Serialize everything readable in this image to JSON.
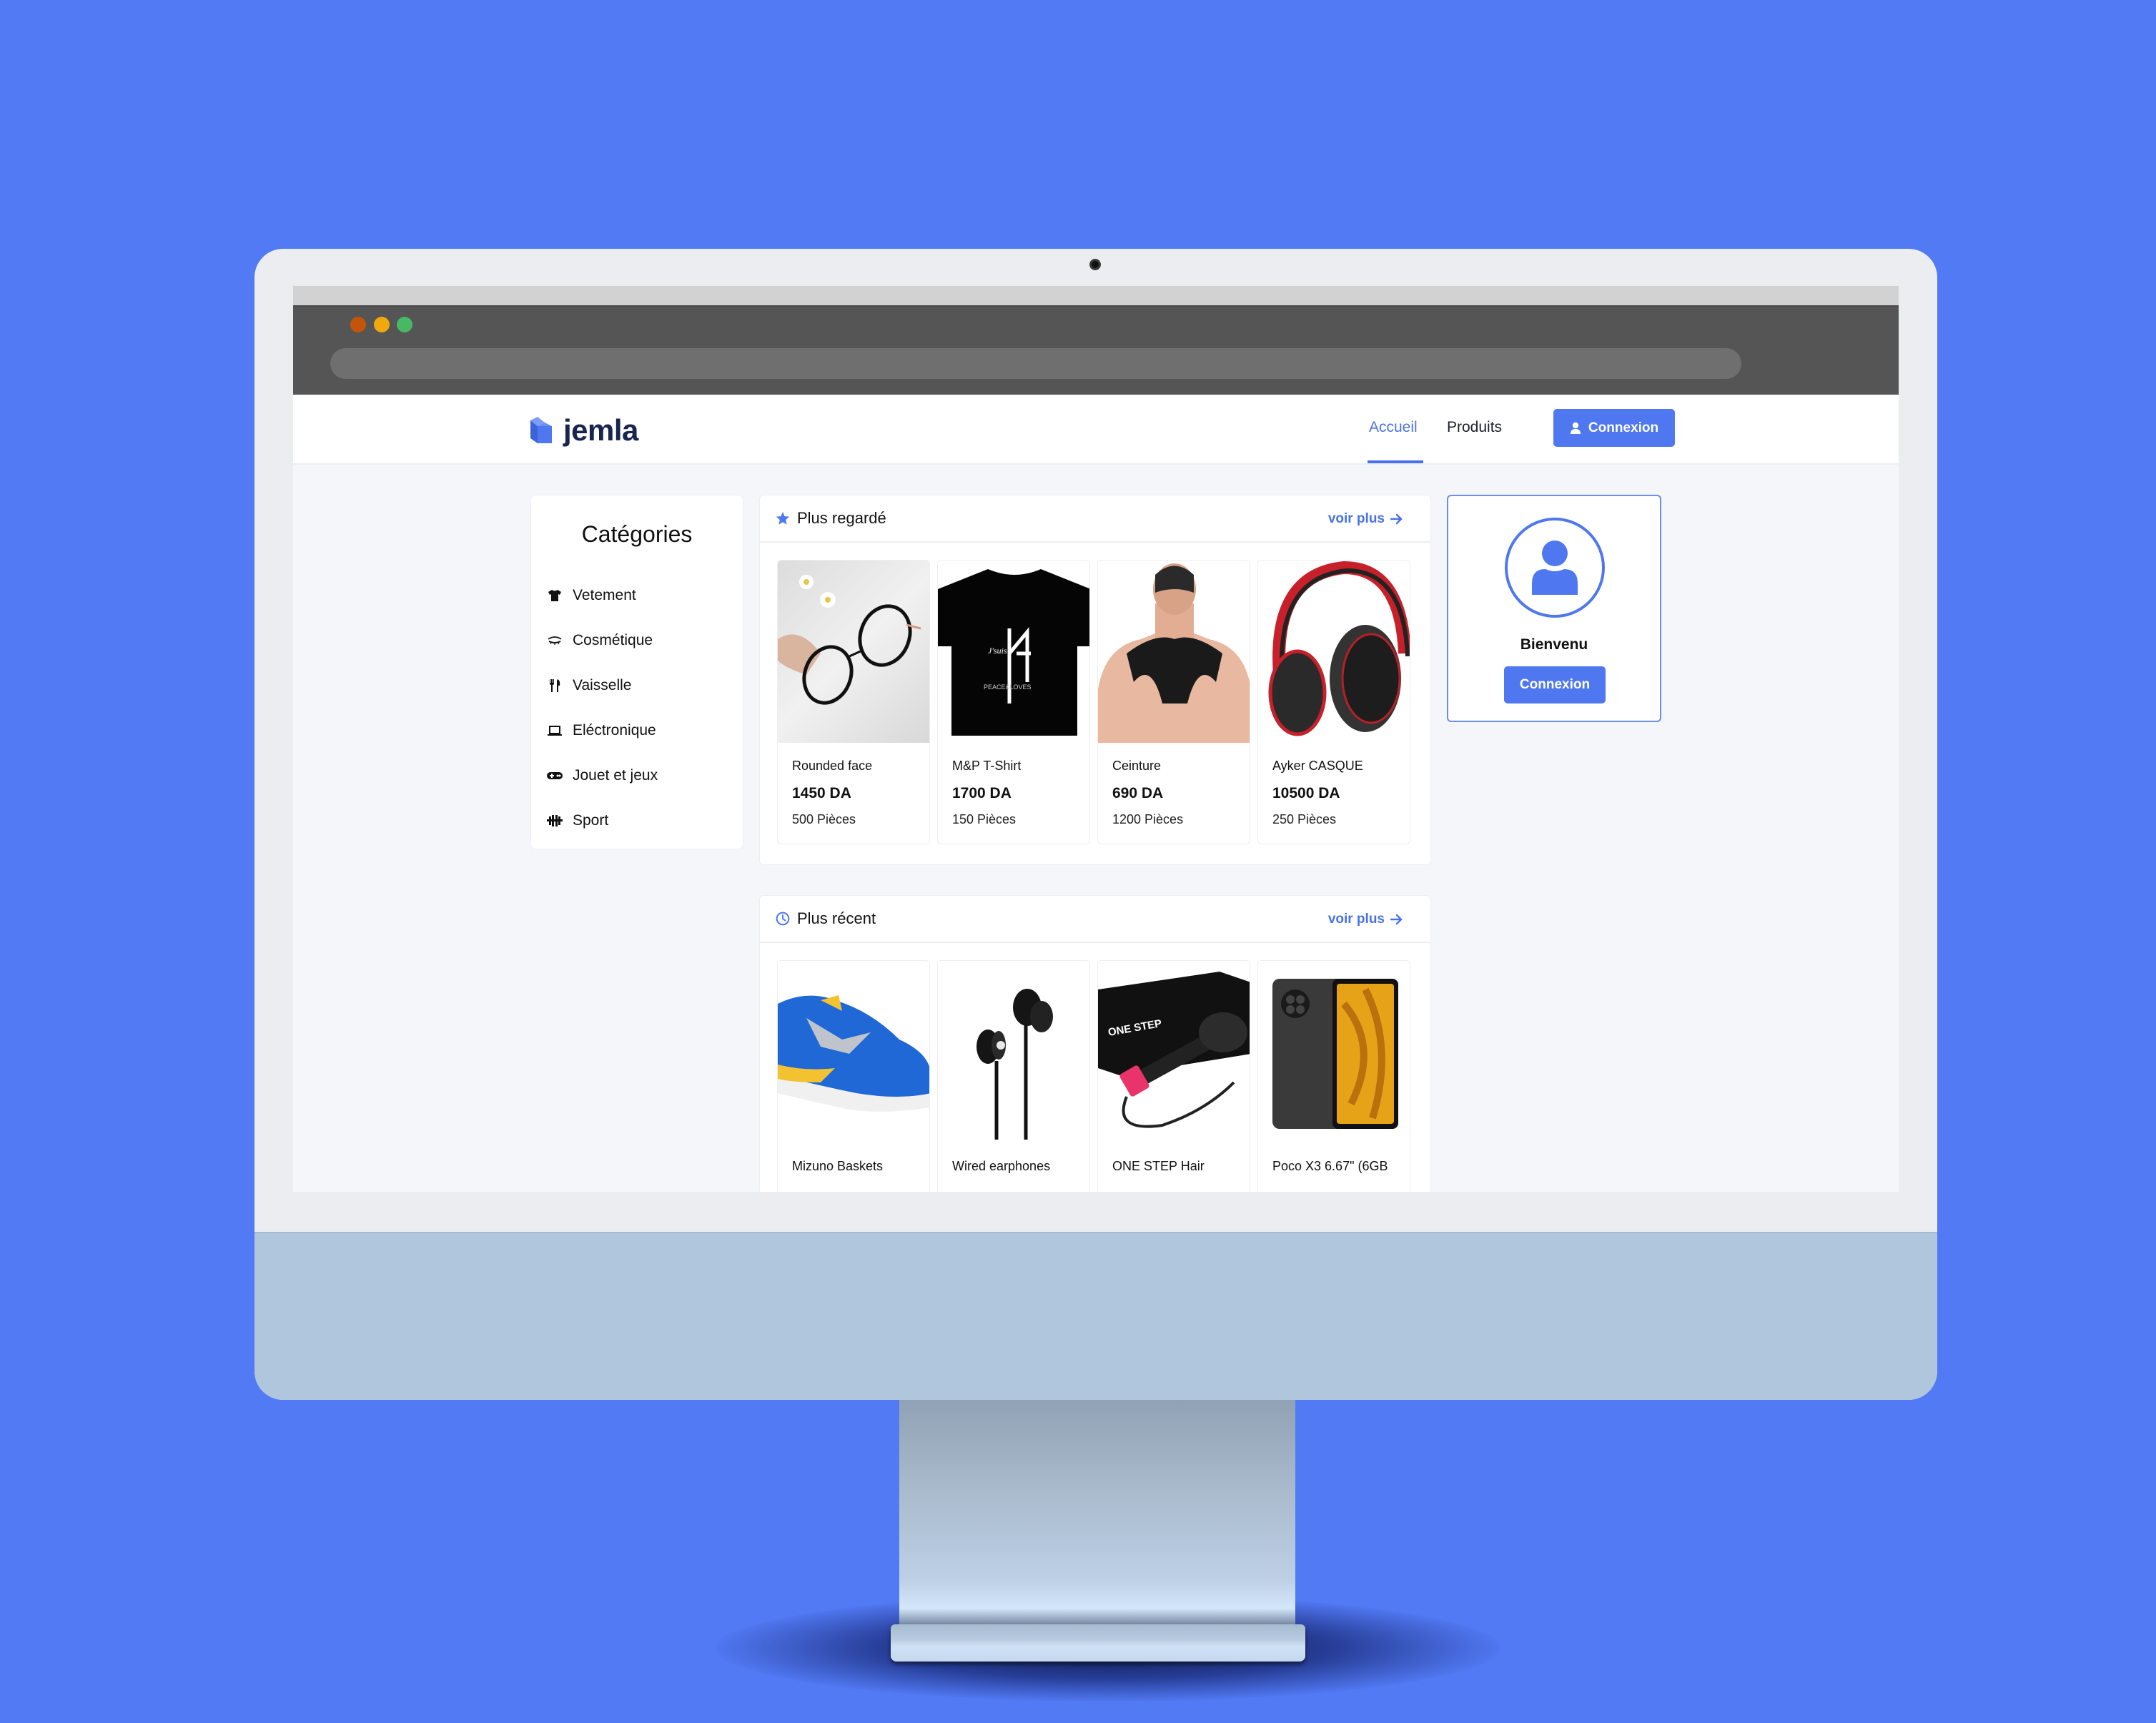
{
  "browser": {
    "window_controls": [
      "close",
      "minimize",
      "maximize"
    ],
    "url": ""
  },
  "header": {
    "brand": "jemla",
    "nav": [
      {
        "label": "Accueil",
        "active": true
      },
      {
        "label": "Produits",
        "active": false
      }
    ],
    "login_button": "Connexion"
  },
  "categories": {
    "title": "Catégories",
    "items": [
      {
        "label": "Vetement",
        "icon": "tshirt-icon"
      },
      {
        "label": "Cosmétique",
        "icon": "eye-lashes-icon"
      },
      {
        "label": "Vaisselle",
        "icon": "utensils-icon"
      },
      {
        "label": "Eléctronique",
        "icon": "laptop-icon"
      },
      {
        "label": "Jouet et jeux",
        "icon": "gamepad-icon"
      },
      {
        "label": "Sport",
        "icon": "dumbbell-icon"
      }
    ]
  },
  "sections": [
    {
      "title": "Plus regardé",
      "icon": "star-icon",
      "more_label": "voir plus",
      "products": [
        {
          "name": "Rounded face",
          "price": "1450 DA",
          "stock": "500 Pièces",
          "image": "glasses"
        },
        {
          "name": "M&P T-Shirt",
          "price": "1700 DA",
          "stock": "150 Pièces",
          "image": "tshirt"
        },
        {
          "name": "Ceinture",
          "price": "690 DA",
          "stock": "1200 Pièces",
          "image": "posture-belt"
        },
        {
          "name": "Ayker CASQUE",
          "price": "10500 DA",
          "stock": "250 Pièces",
          "image": "headphones"
        }
      ]
    },
    {
      "title": "Plus récent",
      "icon": "clock-icon",
      "more_label": "voir plus",
      "products": [
        {
          "name": "Mizuno Baskets",
          "image": "sneaker"
        },
        {
          "name": "Wired earphones",
          "image": "earphones"
        },
        {
          "name": "ONE STEP Hair",
          "image": "hair-dryer-brush"
        },
        {
          "name": "Poco X3 6.67\" (6GB",
          "image": "smartphone"
        }
      ]
    }
  ],
  "welcome_card": {
    "greeting": "Bienvenu",
    "button": "Connexion"
  },
  "colors": {
    "accent": "#4f78f0",
    "brand_text": "#17254f",
    "background": "#527af5"
  }
}
